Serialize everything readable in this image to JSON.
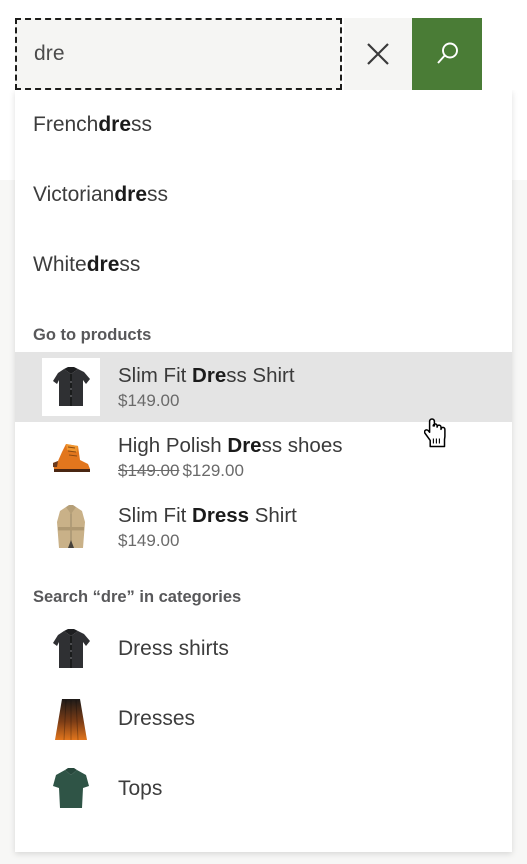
{
  "search": {
    "value": "dre",
    "placeholder": "Search products",
    "clear_icon": "close-icon",
    "submit_icon": "search-icon",
    "accent_color": "#4a7c36",
    "field_bg": "#f5f5f3"
  },
  "dropdown": {
    "suggestions": [
      {
        "prefix": "French ",
        "match": "dre",
        "suffix": "ss"
      },
      {
        "prefix": "Victorian ",
        "match": "dre",
        "suffix": "ss"
      },
      {
        "prefix": "White ",
        "match": "dre",
        "suffix": "ss"
      }
    ],
    "products_header": "Go to products",
    "products": [
      {
        "prefix": "Slim Fit ",
        "match": "Dre",
        "suffix": "ss Shirt",
        "price": "$149.00",
        "old_price": "",
        "thumb": "black-dress-shirt-thumb",
        "active": true
      },
      {
        "prefix": "High Polish ",
        "match": "Dre",
        "suffix": "ss shoes",
        "price": "$129.00",
        "old_price": "$149.00",
        "thumb": "orange-dress-shoe-thumb",
        "active": false
      },
      {
        "prefix": "Slim Fit ",
        "match": "Dress",
        "suffix": " Shirt",
        "price": "$149.00",
        "old_price": "",
        "thumb": "tan-trench-coat-thumb",
        "active": false
      }
    ],
    "categories_header": "Search “dre” in categories",
    "categories": [
      {
        "label": "Dress shirts",
        "thumb": "black-dress-shirt-thumb"
      },
      {
        "label": "Dresses",
        "thumb": "orange-skirt-thumb"
      },
      {
        "label": "Tops",
        "thumb": "green-tshirt-thumb"
      }
    ],
    "highlight_color": "#e4e4e4"
  },
  "cursor": {
    "type": "pointing-hand-cursor"
  }
}
